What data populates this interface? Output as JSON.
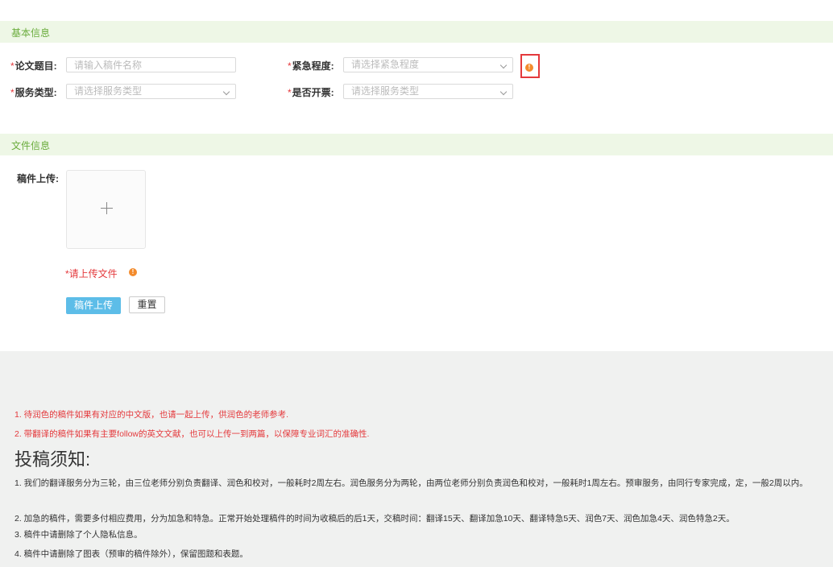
{
  "sections": {
    "basic_info": "基本信息",
    "file_info": "文件信息"
  },
  "form": {
    "required_mark": "*",
    "title_label": "论文题目:",
    "title_placeholder": "请输入稿件名称",
    "urgency_label": "紧急程度:",
    "urgency_placeholder": "请选择紧急程度",
    "service_label": "服务类型:",
    "service_placeholder": "请选择服务类型",
    "invoice_label": "是否开票:",
    "invoice_placeholder": "请选择服务类型"
  },
  "upload": {
    "label": "稿件上传:",
    "error_text": "*请上传文件",
    "upload_button": "稿件上传",
    "reset_button": "重置"
  },
  "icons": {
    "warning_glyph": "!",
    "plus": "plus-icon",
    "chevron": "chevron-down-icon"
  },
  "notice": {
    "red_lines": [
      "1. 待润色的稿件如果有对应的中文版，也请一起上传，供润色的老师参考.",
      "2. 带翻译的稿件如果有主要follow的英文文献，也可以上传一到两篇，以保障专业词汇的准确性."
    ],
    "heading": "投稿须知:",
    "items": [
      "1. 我们的翻译服务分为三轮，由三位老师分别负责翻译、润色和校对，一般耗时2周左右。润色服务分为两轮，由两位老师分别负责润色和校对，一般耗时1周左右。预审服务，由同行专家完成，定，一般2周以内。",
      "2. 加急的稿件，需要多付相应费用，分为加急和特急。正常开始处理稿件的时间为收稿后的后1天，交稿时间：翻译15天、翻译加急10天、翻译特急5天、润色7天、润色加急4天、润色特急2天。",
      "3. 稿件中请删除了个人隐私信息。",
      "4. 稿件中请删除了图表（预审的稿件除外），保留图题和表题。"
    ]
  },
  "colors": {
    "section_bg": "#eef7e6",
    "section_text": "#6aac3c",
    "required": "#e4393c",
    "warning": "#f38b2c",
    "primary_button": "#5dbde8",
    "notice_bg": "#f0f1f0"
  }
}
